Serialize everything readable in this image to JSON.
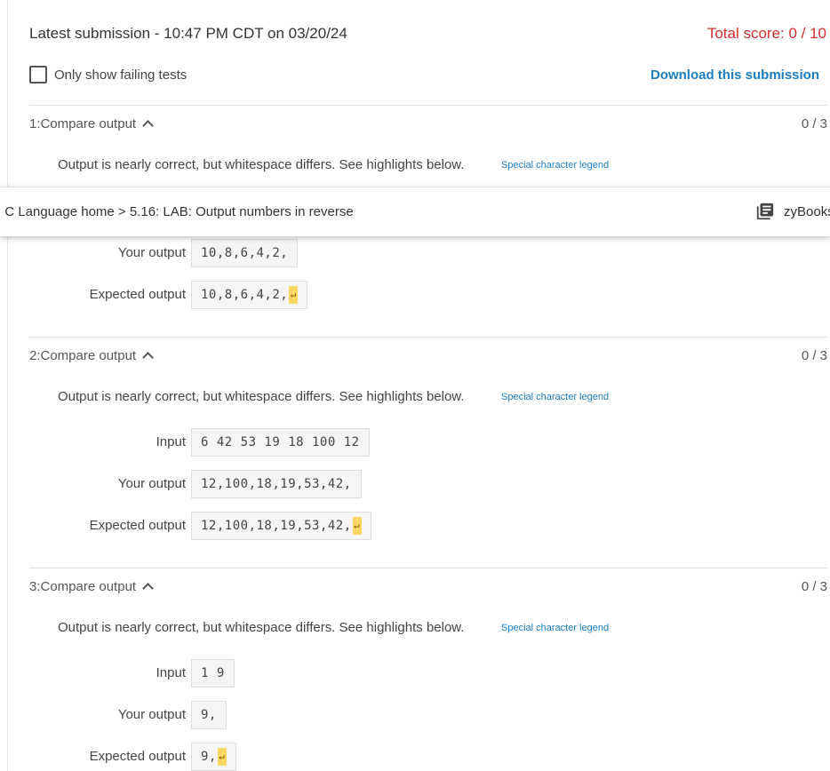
{
  "header": {
    "title": "Latest submission - 10:47 PM CDT on 03/20/24",
    "total_score": "Total score: 0 / 10"
  },
  "controls": {
    "failing_label": "Only show failing tests",
    "download_label": "Download this submission"
  },
  "overlay": {
    "breadcrumb": ": C Language home > 5.16: LAB: Output numbers in reverse",
    "zybooks_label": "zyBooks"
  },
  "tests": [
    {
      "title": "1:Compare output",
      "score": "0 / 3",
      "message": "Output is nearly correct, but whitespace differs. See highlights below.",
      "legend": "Special character legend",
      "your_label": "Your output",
      "your_output": "10,8,6,4,2,",
      "expected_label": "Expected output",
      "expected_output": "10,8,6,4,2,",
      "newline_marker": "↵"
    },
    {
      "title": "2:Compare output",
      "score": "0 / 3",
      "message": "Output is nearly correct, but whitespace differs. See highlights below.",
      "legend": "Special character legend",
      "input_label": "Input",
      "input": "6 42 53 19 18 100 12",
      "your_label": "Your output",
      "your_output": "12,100,18,19,53,42,",
      "expected_label": "Expected output",
      "expected_output": "12,100,18,19,53,42,",
      "newline_marker": "↵"
    },
    {
      "title": "3:Compare output",
      "score": "0 / 3",
      "message": "Output is nearly correct, but whitespace differs. See highlights below.",
      "legend": "Special character legend",
      "input_label": "Input",
      "input": "1 9",
      "your_label": "Your output",
      "your_output": "9,",
      "expected_label": "Expected output",
      "expected_output": "9,",
      "newline_marker": "↵"
    }
  ]
}
